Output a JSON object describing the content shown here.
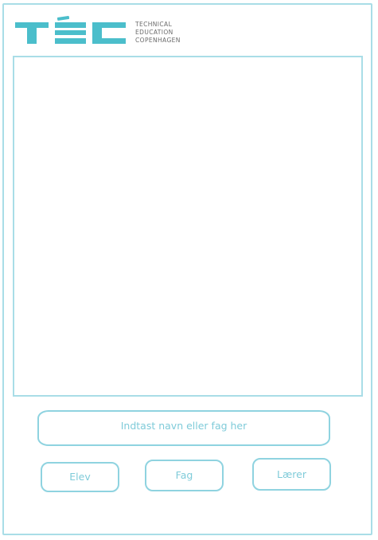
{
  "header": {
    "logo": {
      "wordmark": "TÉC",
      "lines": [
        "TECHNICAL",
        "EDUCATION",
        "COPENHAGEN"
      ],
      "color": "#4bbecb",
      "text_color": "#6a6a6a"
    }
  },
  "main": {
    "content_area": {
      "border_color": "#a9dde7"
    },
    "search": {
      "placeholder": "Indtast navn eller fag her",
      "value": ""
    },
    "buttons": {
      "elev_label": "Elev",
      "fag_label": "Fag",
      "laerer_label": "Lærer"
    }
  },
  "theme": {
    "accent": "#8fd3e0",
    "text": "#7fcbd9"
  }
}
